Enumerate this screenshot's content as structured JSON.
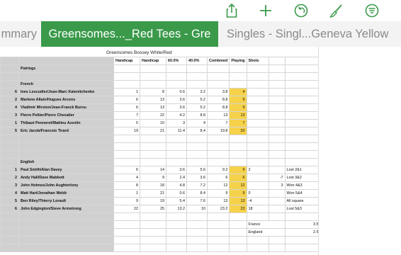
{
  "toolbar": {
    "icons": [
      "share-icon",
      "add-icon",
      "undo-icon",
      "format-brush-icon",
      "organize-icon"
    ],
    "accent": "#3a9a4a"
  },
  "tabs": [
    {
      "label": "mmary",
      "active": false
    },
    {
      "label": "Greensomes..._Red Tees - Gre",
      "active": true
    },
    {
      "label": "Singles - Singl...Geneva Yellow",
      "active": false
    }
  ],
  "sheet": {
    "title": "Greensomes Bossey White/Red",
    "headers": [
      "Handicap",
      "Handicap",
      "60.0%",
      "40.0%",
      "Combined",
      "Playing",
      "Shots"
    ],
    "section1": {
      "label": "Pairings",
      "group": "French"
    },
    "french": [
      {
        "n": "6",
        "name": "Ines Lescudier/Jean-Marc Kalenitchenko",
        "h1": "1",
        "h2": "8",
        "p60": "0.6",
        "p40": "3.2",
        "comb": "3.8",
        "play": "4",
        "shots": "",
        "extra": "",
        "result": ""
      },
      {
        "n": "2",
        "name": "Marlene Allain/Hugues Arcens",
        "h1": "6",
        "h2": "13",
        "p60": "3.6",
        "p40": "5.2",
        "comb": "8.8",
        "play": "9",
        "shots": "",
        "extra": "",
        "result": ""
      },
      {
        "n": "4",
        "name": "Vladimir Mirston/Jean-Franck Burou",
        "h1": "6",
        "h2": "13",
        "p60": "3.6",
        "p40": "5.2",
        "comb": "8.8",
        "play": "9",
        "shots": "",
        "extra": "",
        "result": ""
      },
      {
        "n": "3",
        "name": "Pierre Peltier/Pierre Chevalier",
        "h1": "7",
        "h2": "22",
        "p60": "4.2",
        "p40": "8.8",
        "comb": "13",
        "play": "13",
        "shots": "",
        "extra": "",
        "result": ""
      },
      {
        "n": "1",
        "name": "Thibaut Penneret/Mattieu Azzolin",
        "h1": "5",
        "h2": "10",
        "p60": "3",
        "p40": "4",
        "comb": "7",
        "play": "7",
        "shots": "",
        "extra": "",
        "result": ""
      },
      {
        "n": "5",
        "name": "Eric Jacob/Francois Tirard",
        "h1": "19",
        "h2": "21",
        "p60": "11.4",
        "p40": "8.4",
        "comb": "19.8",
        "play": "20",
        "shots": "",
        "extra": "",
        "result": ""
      }
    ],
    "group2": "English",
    "english": [
      {
        "n": "1",
        "name": "Paul Smith/Alan Davey",
        "h1": "6",
        "h2": "14",
        "p60": "3.6",
        "p40": "5.6",
        "comb": "9.2",
        "play": "9",
        "shots": "2",
        "extra": "",
        "result": "Lost 2&1"
      },
      {
        "n": "2",
        "name": "Andy Hall/Dave Mabbott",
        "h1": "4",
        "h2": "9",
        "p60": "2.4",
        "p40": "3.6",
        "comb": "6",
        "play": "6",
        "shots": "",
        "extra": "-7",
        "result": "Lost 3&2"
      },
      {
        "n": "3",
        "name": "John Holmes/John Aughterlony",
        "h1": "8",
        "h2": "18",
        "p60": "4.8",
        "p40": "7.2",
        "comb": "12",
        "play": "12",
        "shots": "",
        "extra": "3",
        "result": "Won 4&3"
      },
      {
        "n": "4",
        "name": "Matt Hart/Jonathan Webb",
        "h1": "1",
        "h2": "21",
        "p60": "0.6",
        "p40": "8.4",
        "comb": "9",
        "play": "9",
        "shots": "0",
        "extra": "",
        "result": "Won 5&4"
      },
      {
        "n": "5",
        "name": "Ben Riley/Thierry Lorault",
        "h1": "9",
        "h2": "19",
        "p60": "5.4",
        "p40": "7.6",
        "comb": "13",
        "play": "13",
        "shots": "-4",
        "extra": "",
        "result": "All square"
      },
      {
        "n": "6",
        "name": "John Edgington/Steve Armstrong",
        "h1": "22",
        "h2": "25",
        "p60": "13.2",
        "p40": "10",
        "comb": "23.2",
        "play": "23",
        "shots": "18",
        "extra": "",
        "result": "Lost 5&3"
      }
    ],
    "totals": [
      {
        "label": "France",
        "value": "3.5"
      },
      {
        "label": "England",
        "value": "2.5"
      }
    ]
  }
}
